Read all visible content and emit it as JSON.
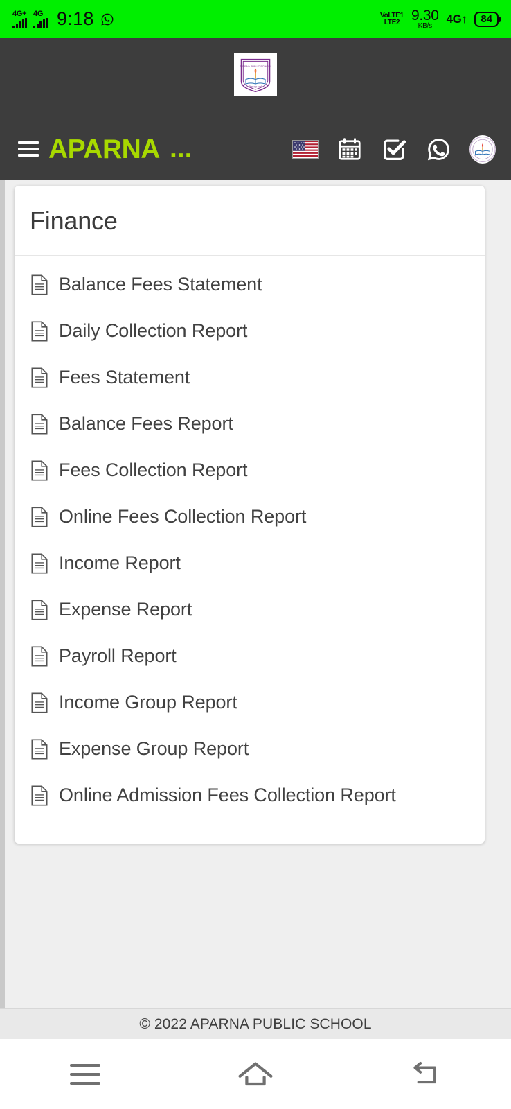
{
  "status_bar": {
    "background": "#00ef00",
    "network_1": "4G+",
    "network_2": "4G",
    "time": "9:18",
    "whatsapp_icon": "whatsapp-icon",
    "volte_line1": "VoLTE1",
    "volte_line2": "LTE2",
    "data_speed": "9.30",
    "data_speed_unit": "KB/s",
    "network_right": "4G↑",
    "battery": "84"
  },
  "header": {
    "background": "#3d3d3d",
    "accent": "#a8d900",
    "logo_alt": "aparna-public-school-crest",
    "menu_icon": "hamburger-menu-icon",
    "brand": "APARNA",
    "brand_ellipsis": "...",
    "icons": [
      {
        "name": "language-flag-icon",
        "label": "English (US)"
      },
      {
        "name": "calendar-icon",
        "label": "Calendar"
      },
      {
        "name": "task-checkbox-icon",
        "label": "Tasks"
      },
      {
        "name": "whatsapp-icon",
        "label": "WhatsApp"
      },
      {
        "name": "profile-avatar-icon",
        "label": "Profile"
      }
    ]
  },
  "card": {
    "title": "Finance",
    "items": [
      {
        "icon": "document-icon",
        "label": "Balance Fees Statement"
      },
      {
        "icon": "document-icon",
        "label": "Daily Collection Report"
      },
      {
        "icon": "document-icon",
        "label": "Fees Statement"
      },
      {
        "icon": "document-icon",
        "label": "Balance Fees Report"
      },
      {
        "icon": "document-icon",
        "label": "Fees Collection Report"
      },
      {
        "icon": "document-icon",
        "label": "Online Fees Collection Report"
      },
      {
        "icon": "document-icon",
        "label": "Income Report"
      },
      {
        "icon": "document-icon",
        "label": "Expense Report"
      },
      {
        "icon": "document-icon",
        "label": "Payroll Report"
      },
      {
        "icon": "document-icon",
        "label": "Income Group Report"
      },
      {
        "icon": "document-icon",
        "label": "Expense Group Report"
      },
      {
        "icon": "document-icon",
        "label": "Online Admission Fees Collection Report"
      }
    ]
  },
  "footer": {
    "text": "© 2022 APARNA PUBLIC SCHOOL"
  },
  "android_nav": {
    "recents": "recents-icon",
    "home": "home-icon",
    "back": "back-icon"
  }
}
